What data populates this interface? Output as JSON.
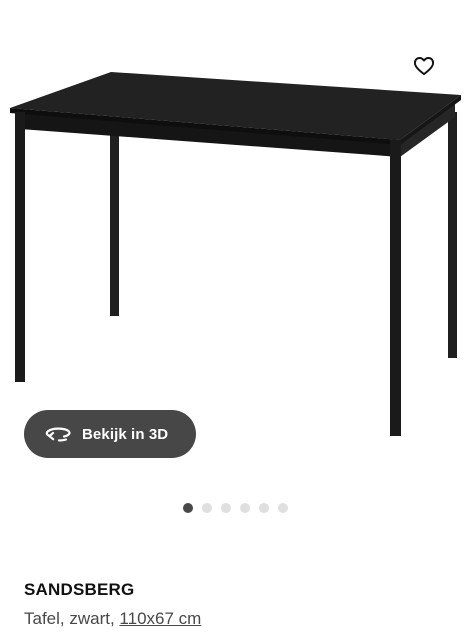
{
  "product": {
    "name": "SANDSBERG",
    "description_prefix": "Tafel, zwart, ",
    "size_link": "110x67 cm"
  },
  "gallery": {
    "view_3d_label": "Bekijk in 3D",
    "view_3d_icon": "rotate-3d-icon",
    "favorite_icon": "heart-outline-icon",
    "image_count": 6,
    "active_image": 1
  },
  "colors": {
    "button_bg": "#474747",
    "dot_active": "#484848",
    "dot_inactive": "#dfdfdf",
    "table": "#1b1b1b"
  }
}
